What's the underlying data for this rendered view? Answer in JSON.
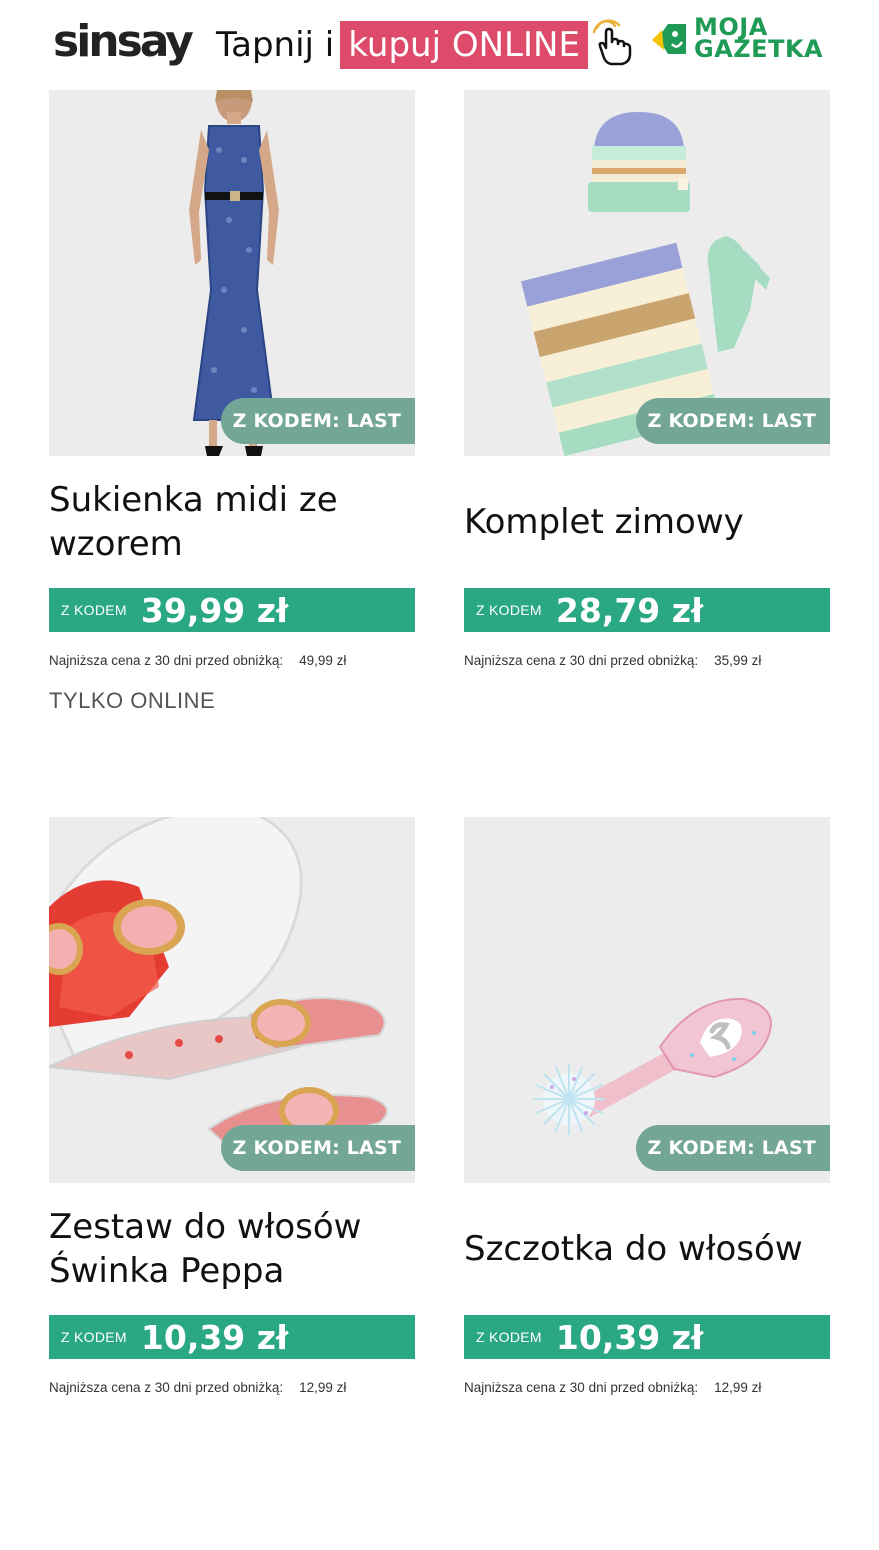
{
  "header": {
    "logo": "sinsay",
    "tagline_plain": "Tapnij i",
    "tagline_highlight": "kupuj ONLINE",
    "partner_logo_line1": "MOJA",
    "partner_logo_line2": "GAZETKA"
  },
  "colors": {
    "green": "#2aa883",
    "badge": "#74a697",
    "pink": "#dd4a6a",
    "partner_green": "#1f9b56"
  },
  "products": [
    {
      "badge": "Z KODEM: LAST",
      "title_line1": "Sukienka midi ze",
      "title_line2": "wzorem",
      "code_label": "Z KODEM",
      "price": "39,99 zł",
      "lowest_label": "Najniższa cena z 30 dni przed obniżką:",
      "lowest_value": "49,99 zł"
    },
    {
      "badge": "Z KODEM: LAST",
      "title_line1": "Komplet zimowy",
      "title_line2": "",
      "code_label": "Z KODEM",
      "price": "28,79 zł",
      "lowest_label": "Najniższa cena z 30 dni przed obniżką:",
      "lowest_value": "35,99 zł"
    },
    {
      "badge": "Z KODEM: LAST",
      "title_line1": "Zestaw do włosów",
      "title_line2": "Świnka Peppa",
      "code_label": "Z KODEM",
      "price": "10,39 zł",
      "lowest_label": "Najniższa cena z 30 dni przed obniżką:",
      "lowest_value": "12,99 zł"
    },
    {
      "badge": "Z KODEM: LAST",
      "title_line1": "Szczotka do włosów",
      "title_line2": "",
      "code_label": "Z KODEM",
      "price": "10,39 zł",
      "lowest_label": "Najniższa cena z 30 dni przed obniżką:",
      "lowest_value": "12,99 zł"
    }
  ],
  "online_only": "TYLKO ONLINE"
}
